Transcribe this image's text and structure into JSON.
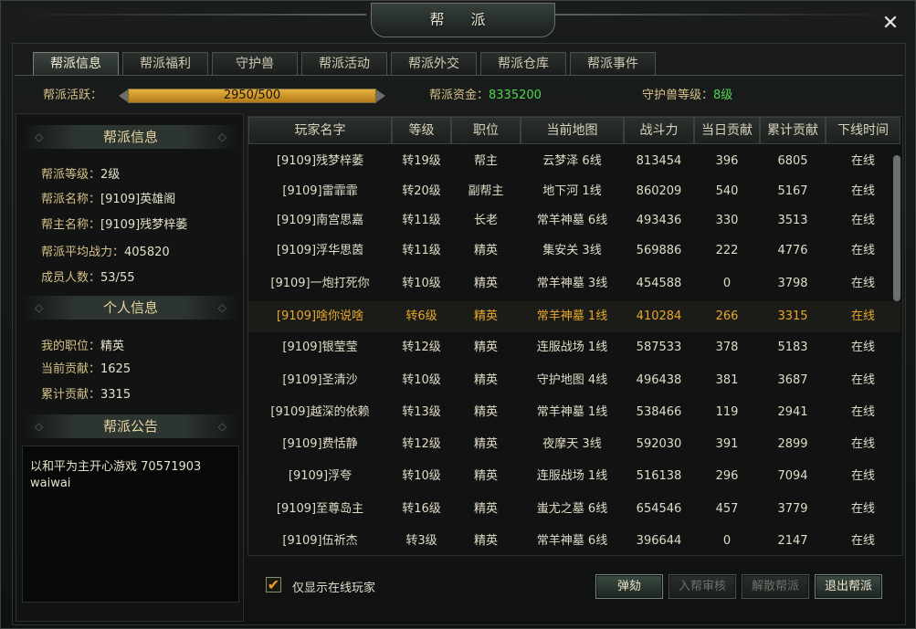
{
  "window": {
    "title": "帮 派",
    "close_glyph": "✕"
  },
  "tabs": [
    {
      "label": "帮派信息"
    },
    {
      "label": "帮派福利"
    },
    {
      "label": "守护兽"
    },
    {
      "label": "帮派活动"
    },
    {
      "label": "帮派外交"
    },
    {
      "label": "帮派仓库"
    },
    {
      "label": "帮派事件"
    }
  ],
  "info_bar": {
    "activity_label": "帮派活跃：",
    "activity_text": "2950/500",
    "activity_fill": 1.0,
    "funds_label": "帮派资金：",
    "funds_value": "8335200",
    "beast_label": "守护兽等级：",
    "beast_value": "8级"
  },
  "guild_info": {
    "header": "帮派信息",
    "level_label": "帮派等级：",
    "level_value": "2级",
    "name_label": "帮派名称：",
    "name_value": "[9109]英雄阁",
    "leader_label": "帮主名称：",
    "leader_value": "[9109]残梦梓萎",
    "power_label": "帮派平均战力：",
    "power_value": "405820",
    "members_label": "成员人数：",
    "members_value": "53/55"
  },
  "personal_info": {
    "header": "个人信息",
    "position_label": "我的职位：",
    "position_value": "精英",
    "current_label": "当前贡献：",
    "current_value": "1625",
    "total_label": "累计贡献：",
    "total_value": "3315"
  },
  "notice": {
    "header": "帮派公告",
    "line1": "以和平为主开心游戏 70571903",
    "line2": "waiwai"
  },
  "table": {
    "columns": [
      "玩家名字",
      "等级",
      "职位",
      "当前地图",
      "战斗力",
      "当日贡献",
      "累计贡献",
      "下线时间"
    ],
    "rows": [
      [
        "[9109]残梦梓萎",
        "转19级",
        "帮主",
        "云梦泽  6线",
        "813454",
        "396",
        "6805",
        "在线"
      ],
      [
        "[9109]雷霏霏",
        "转20级",
        "副帮主",
        "地下河  1线",
        "860209",
        "540",
        "5167",
        "在线"
      ],
      [
        "[9109]南宫思嘉",
        "转11级",
        "长老",
        "常羊神墓  6线",
        "493436",
        "330",
        "3513",
        "在线"
      ],
      [
        "[9109]浮华思茵",
        "转11级",
        "精英",
        "集安关  3线",
        "569886",
        "222",
        "4776",
        "在线"
      ],
      [
        "[9109]一炮打死你",
        "转10级",
        "精英",
        "常羊神墓  3线",
        "454588",
        "0",
        "3798",
        "在线"
      ],
      [
        "[9109]啥你说啥",
        "转6级",
        "精英",
        "常羊神墓  1线",
        "410284",
        "266",
        "3315",
        "在线"
      ],
      [
        "[9109]银莹莹",
        "转12级",
        "精英",
        "连服战场  1线",
        "587533",
        "378",
        "5183",
        "在线"
      ],
      [
        "[9109]圣清沙",
        "转10级",
        "精英",
        "守护地图  4线",
        "496438",
        "381",
        "3687",
        "在线"
      ],
      [
        "[9109]越深的依赖",
        "转13级",
        "精英",
        "常羊神墓  1线",
        "538466",
        "119",
        "2941",
        "在线"
      ],
      [
        "[9109]费恬静",
        "转12级",
        "精英",
        "夜摩天  3线",
        "592030",
        "391",
        "2899",
        "在线"
      ],
      [
        "[9109]浮夸",
        "转10级",
        "精英",
        "连服战场  1线",
        "516138",
        "296",
        "7094",
        "在线"
      ],
      [
        "[9109]至尊岛主",
        "转16级",
        "精英",
        "蚩尤之墓  6线",
        "654546",
        "457",
        "3779",
        "在线"
      ],
      [
        "[9109]伍祈杰",
        "转3级",
        "精英",
        "常羊神墓  6线",
        "396644",
        "0",
        "2147",
        "在线"
      ]
    ],
    "highlight_row": 5
  },
  "footer": {
    "online_only_label": "仅显示在线玩家",
    "online_only_checked": true,
    "check_glyph": "✔",
    "impeach_button": "弹劾",
    "review_button": "入帮审核",
    "disband_button": "解散帮派",
    "quit_button": "退出帮派"
  },
  "colors": {
    "gold_label": "#d6c08a",
    "highlight_text": "#e8a82c",
    "green_value": "#4fd64f"
  }
}
